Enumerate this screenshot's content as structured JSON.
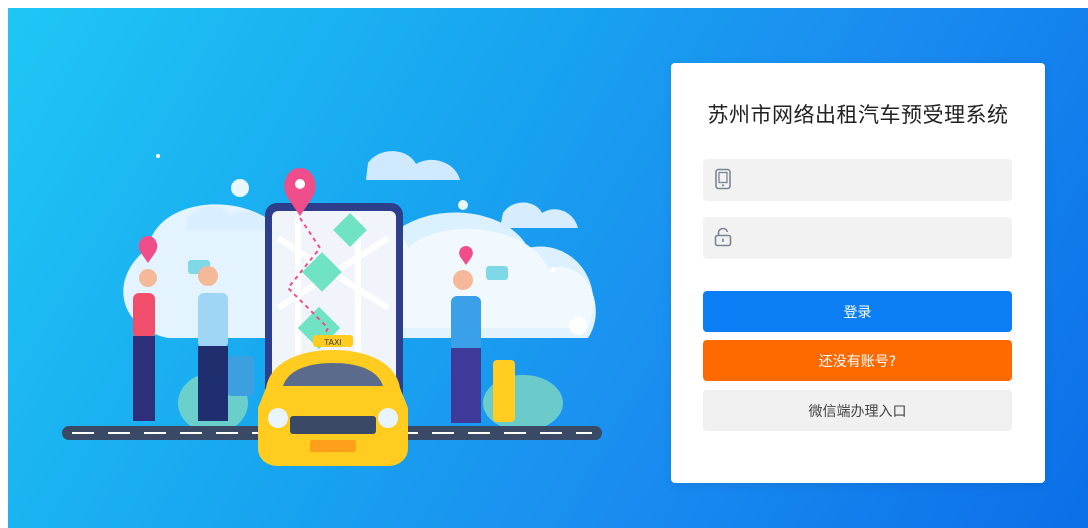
{
  "login": {
    "title": "苏州市网络出租汽车预受理系统",
    "phone_icon": "mobile-phone-icon",
    "phone_value": "",
    "password_icon": "lock-icon",
    "password_value": "",
    "login_label": "登录",
    "register_label": "还没有账号?",
    "wechat_label": "微信端办理入口"
  },
  "illustration": {
    "taxi_sign": "TAXI"
  },
  "colors": {
    "login_button": "#0c7ef5",
    "register_button": "#ff6a00",
    "wechat_button": "#f0f0f0",
    "taxi": "#ffcc1f"
  }
}
